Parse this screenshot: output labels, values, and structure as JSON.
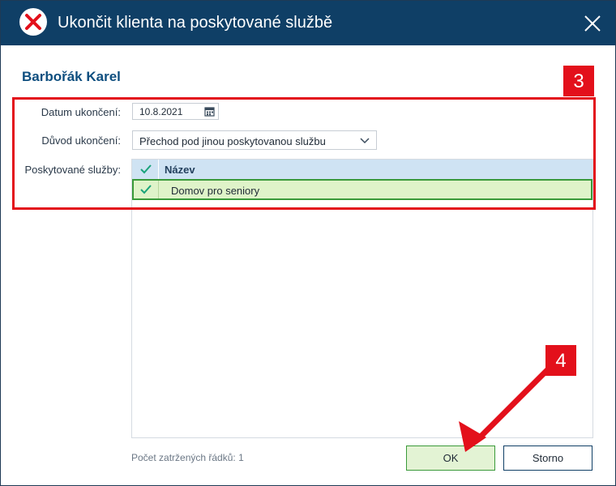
{
  "window": {
    "title": "Ukončit klienta na poskytované službě",
    "icons": {
      "app": "error-x-icon",
      "close": "close-icon"
    }
  },
  "client": {
    "name": "Barbořák Karel"
  },
  "form": {
    "end_date_label": "Datum ukončení:",
    "end_date_value": "10.8.2021",
    "reason_label": "Důvod ukončení:",
    "reason_value": "Přechod pod jinou poskytovanou službu",
    "services_label": "Poskytované služby:"
  },
  "grid": {
    "header": "Název",
    "rows": [
      {
        "label": "Domov pro seniory",
        "checked": true
      }
    ]
  },
  "status": {
    "checked_rows": "Počet zatržených řádků: 1"
  },
  "buttons": {
    "ok": "OK",
    "cancel": "Storno"
  },
  "annotations": {
    "step3": "3",
    "step4": "4"
  },
  "colors": {
    "titlebar": "#0f3f66",
    "accent_blue": "#0e4e7f",
    "annotation_red": "#e3101b",
    "selected_row": "#dff3c9",
    "check_green": "#1aa37a"
  }
}
